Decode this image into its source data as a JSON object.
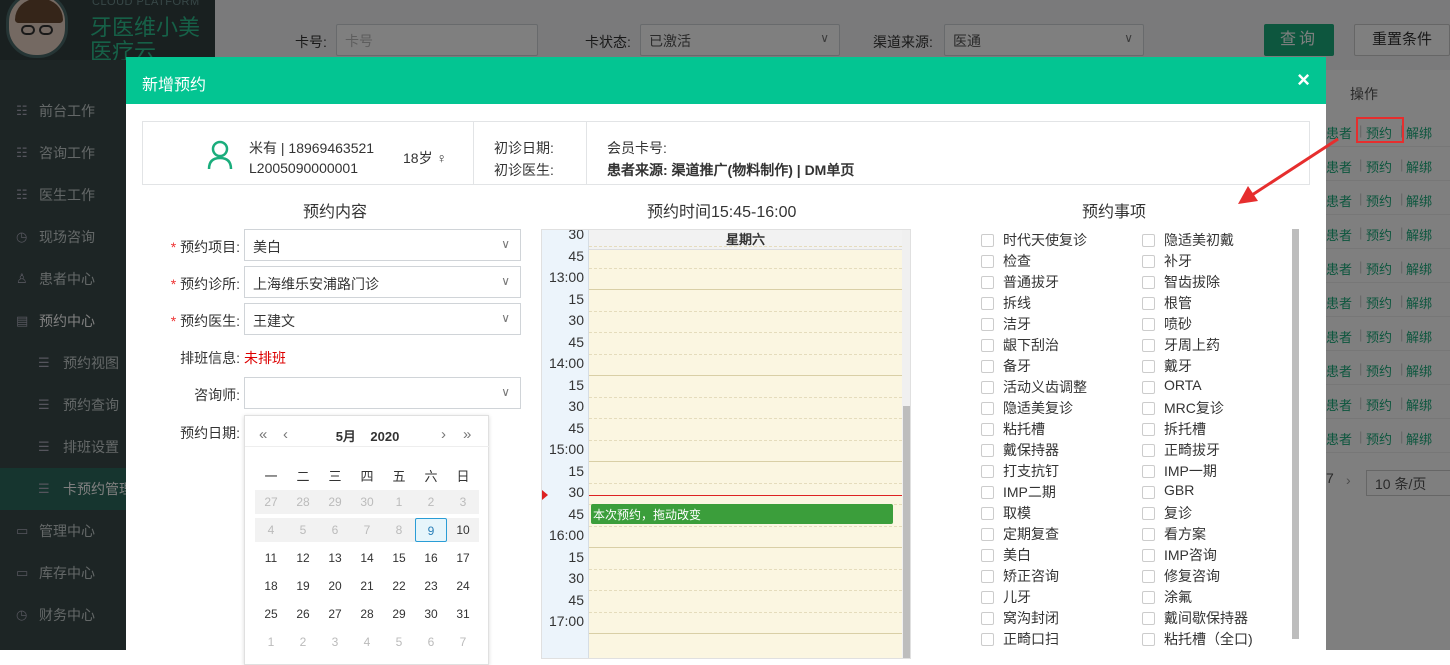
{
  "logo": {
    "cloud": "CLOUD PLATFORM",
    "line1": "牙医维小美",
    "line2": "医疗云"
  },
  "sidebar": {
    "items": [
      {
        "label": "前台工作",
        "icon": "list-icon"
      },
      {
        "label": "咨询工作",
        "icon": "list-icon"
      },
      {
        "label": "医生工作",
        "icon": "list-icon"
      },
      {
        "label": "现场咨询",
        "icon": "clock-icon"
      },
      {
        "label": "患者中心",
        "icon": "user-icon"
      },
      {
        "label": "预约中心",
        "icon": "calendar-icon"
      },
      {
        "label": "预约视图",
        "icon": "menu-icon"
      },
      {
        "label": "预约查询",
        "icon": "menu-icon"
      },
      {
        "label": "排班设置",
        "icon": "menu-icon"
      },
      {
        "label": "卡预约管理",
        "icon": "menu-icon"
      },
      {
        "label": "管理中心",
        "icon": "folder-icon"
      },
      {
        "label": "库存中心",
        "icon": "folder-icon"
      },
      {
        "label": "财务中心",
        "icon": "clock-icon"
      }
    ]
  },
  "filters": {
    "card_label": "卡号:",
    "card_placeholder": "卡号",
    "status_label": "卡状态:",
    "status_value": "已激活",
    "channel_label": "渠道来源:",
    "channel_value": "医通",
    "query_btn": "查询",
    "reset_btn": "重置条件"
  },
  "table": {
    "op_header": "操作",
    "rows": [
      {
        "a": "患者",
        "b": "预约",
        "c": "解绑"
      },
      {
        "a": "患者",
        "b": "预约",
        "c": "解绑"
      },
      {
        "a": "患者",
        "b": "预约",
        "c": "解绑"
      },
      {
        "a": "患者",
        "b": "预约",
        "c": "解绑"
      },
      {
        "a": "患者",
        "b": "预约",
        "c": "解绑"
      },
      {
        "a": "患者",
        "b": "预约",
        "c": "解绑"
      },
      {
        "a": "患者",
        "b": "预约",
        "c": "解绑"
      },
      {
        "a": "患者",
        "b": "预约",
        "c": "解绑"
      },
      {
        "a": "患者",
        "b": "预约",
        "c": "解绑"
      },
      {
        "a": "患者",
        "b": "预约",
        "c": "解绑"
      }
    ],
    "pager_num": "7",
    "pager_size": "10 条/页"
  },
  "modal": {
    "title": "新增预约",
    "close": "×",
    "patient": {
      "name": "米有 | 18969463521",
      "id": "L2005090000001",
      "age": "18岁 ♀",
      "first_date_label": "初诊日期:",
      "first_doctor_label": "初诊医生:",
      "card_no_label": "会员卡号:",
      "source": "患者来源:  渠道推广(物料制作) | DM单页"
    },
    "section_content": "预约内容",
    "section_time": "预约时间15:45-16:00",
    "section_items": "预约事项",
    "form": {
      "project_label": "预约项目:",
      "project_value": "美白",
      "clinic_label": "预约诊所:",
      "clinic_value": "上海维乐安浦路门诊",
      "doctor_label": "预约医生:",
      "doctor_value": "王建文",
      "schedule_label": "排班信息:",
      "schedule_value": "未排班",
      "consultant_label": "咨询师:",
      "consultant_value": "",
      "date_label": "预约日期:"
    },
    "calendar": {
      "month": "5月",
      "year": "2020",
      "prev_year": "«",
      "prev_month": "‹",
      "next_month": "›",
      "next_year": "»",
      "weekdays": [
        "一",
        "二",
        "三",
        "四",
        "五",
        "六",
        "日"
      ],
      "weeks": [
        [
          "27",
          "28",
          "29",
          "30",
          "1",
          "2",
          "3"
        ],
        [
          "4",
          "5",
          "6",
          "7",
          "8",
          "9",
          "10"
        ],
        [
          "11",
          "12",
          "13",
          "14",
          "15",
          "16",
          "17"
        ],
        [
          "18",
          "19",
          "20",
          "21",
          "22",
          "23",
          "24"
        ],
        [
          "25",
          "26",
          "27",
          "28",
          "29",
          "30",
          "31"
        ],
        [
          "1",
          "2",
          "3",
          "4",
          "5",
          "6",
          "7"
        ]
      ],
      "selected": "9"
    },
    "schedule": {
      "day": "星期六",
      "times": [
        "30",
        "45",
        "13:00",
        "15",
        "30",
        "45",
        "14:00",
        "15",
        "30",
        "45",
        "15:00",
        "15",
        "30",
        "45",
        "16:00",
        "15",
        "30",
        "45",
        "17:00"
      ],
      "event": "本次预约，拖动改变"
    },
    "items_left": [
      "时代天使复诊",
      "检查",
      "普通拔牙",
      "拆线",
      "洁牙",
      "龈下刮治",
      "备牙",
      "活动义齿调整",
      "隐适美复诊",
      "粘托槽",
      "戴保持器",
      "打支抗钉",
      "IMP二期",
      "取模",
      "定期复查",
      "美白",
      "矫正咨询",
      "儿牙",
      "窝沟封闭",
      "正畸口扫"
    ],
    "items_right": [
      "隐适美初戴",
      "补牙",
      "智齿拔除",
      "根管",
      "喷砂",
      "牙周上药",
      "戴牙",
      "ORTA",
      "MRC复诊",
      "拆托槽",
      "正畸拔牙",
      "IMP一期",
      "GBR",
      "复诊",
      "看方案",
      "IMP咨询",
      "修复咨询",
      "涂氟",
      "戴间歇保持器",
      "粘托槽（全口)"
    ]
  },
  "colors": {
    "accent": "#03c592",
    "sidebar": "#3a4a4a",
    "highlight": "#e62e2e"
  }
}
